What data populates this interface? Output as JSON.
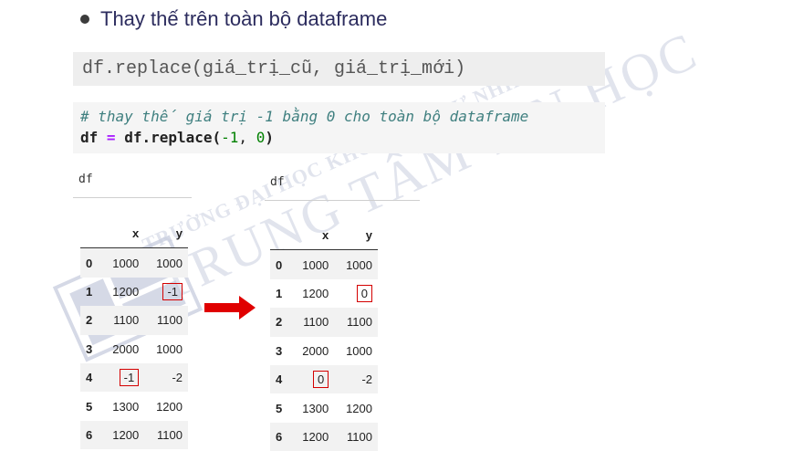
{
  "slide": {
    "bullet": "Thay thế trên toàn bộ dataframe",
    "syntax": "df.replace(giá_trị_cũ, giá_trị_mới)"
  },
  "code_cell": {
    "comment": "# thay thế giá trị -1 bằng 0 cho toàn bộ dataframe",
    "line2": {
      "var": "df",
      "eq": "=",
      "call": "df.replace(",
      "arg1": "-1",
      "sep": ", ",
      "arg2": "0",
      "close": ")"
    }
  },
  "input_before": "df",
  "input_after": "df",
  "table_before": {
    "columns": [
      "",
      "x",
      "y"
    ],
    "rows": [
      {
        "idx": "0",
        "x": "1000",
        "y": "1000"
      },
      {
        "idx": "1",
        "x": "1200",
        "y": "-1"
      },
      {
        "idx": "2",
        "x": "1100",
        "y": "1100"
      },
      {
        "idx": "3",
        "x": "2000",
        "y": "1000"
      },
      {
        "idx": "4",
        "x": "-1",
        "y": "-2"
      },
      {
        "idx": "5",
        "x": "1300",
        "y": "1200"
      },
      {
        "idx": "6",
        "x": "1200",
        "y": "1100"
      }
    ]
  },
  "table_after": {
    "columns": [
      "",
      "x",
      "y"
    ],
    "rows": [
      {
        "idx": "0",
        "x": "1000",
        "y": "1000"
      },
      {
        "idx": "1",
        "x": "1200",
        "y": "0"
      },
      {
        "idx": "2",
        "x": "1100",
        "y": "1100"
      },
      {
        "idx": "3",
        "x": "2000",
        "y": "1000"
      },
      {
        "idx": "4",
        "x": "0",
        "y": "-2"
      },
      {
        "idx": "5",
        "x": "1300",
        "y": "1200"
      },
      {
        "idx": "6",
        "x": "1200",
        "y": "1100"
      }
    ]
  },
  "watermark": {
    "line1": "TRƯỜNG ĐẠI HỌC KHOA HỌC TỰ NHIÊN",
    "line2": "TRUNG TÂM TIN HỌC"
  },
  "colors": {
    "highlight": "#d40000",
    "arrow": "#e00000"
  }
}
